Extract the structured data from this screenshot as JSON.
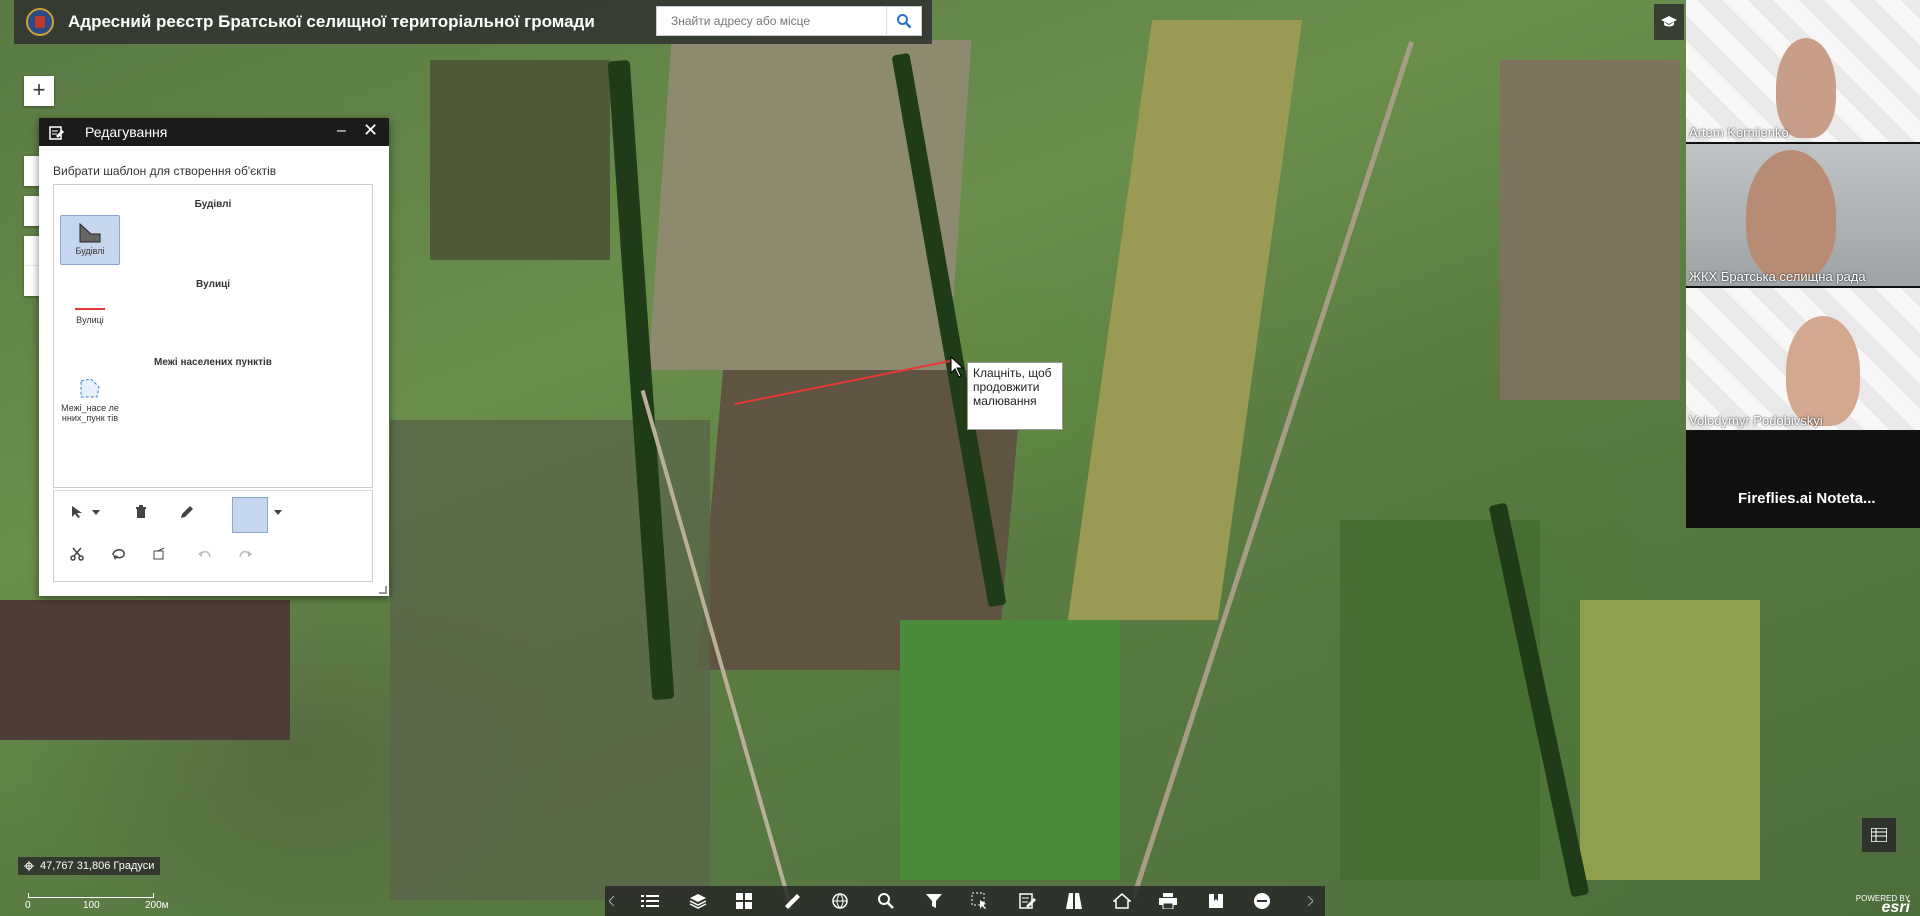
{
  "header": {
    "title": "Адресний реєстр Братської селищної територіальної громади",
    "search_placeholder": "Знайти адресу або місце"
  },
  "zoom": {
    "plus": "+"
  },
  "edit_panel": {
    "title": "Редагування",
    "minimize": "–",
    "close": "✕",
    "pick_label": "Вибрати шаблон для створення об'єктів",
    "groups": [
      {
        "heading": "Будівлі",
        "item": "Будівлі"
      },
      {
        "heading": "Вулиці",
        "item": "Вулиці"
      },
      {
        "heading": "Межі населених пунктів",
        "item": "Межі_насе ленних_пунк тів"
      }
    ]
  },
  "tooltip": {
    "text": "Клацніть, щоб продовжити малювання"
  },
  "participants": [
    {
      "name": "Artem Korniienko"
    },
    {
      "name": "ЖКХ Братська селищна рада"
    },
    {
      "name": "Volodymyr Podobivskyi"
    }
  ],
  "notetakers": "Fireflies.ai  Noteta...",
  "coords": {
    "text": "47,767 31,806 Градуси"
  },
  "scale": {
    "labels": [
      "0",
      "100",
      "200м"
    ]
  },
  "esri": {
    "powered": "POWERED BY",
    "brand": "esri"
  },
  "icons": {
    "search": "search-icon",
    "close": "close-icon",
    "minimize": "minimize-icon",
    "select": "cursor-icon",
    "delete": "trash-icon",
    "edit": "pencil-icon",
    "cut": "scissors-icon",
    "reshape": "reshape-icon",
    "undo": "undo-icon",
    "redo": "redo-icon"
  },
  "colors": {
    "street_line": "#e53935",
    "selected_template": "#c7d6ef",
    "boundary": "#3b7fd4"
  }
}
